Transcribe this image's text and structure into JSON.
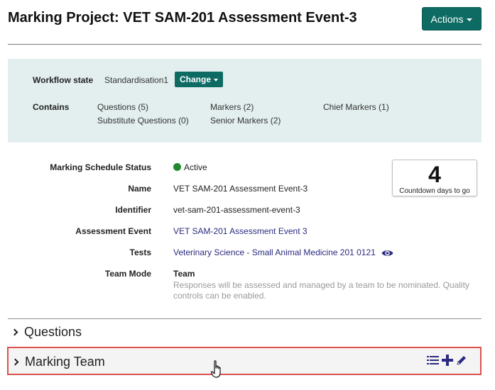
{
  "header": {
    "title": "Marking Project: VET SAM-201 Assessment Event-3",
    "actions_label": "Actions"
  },
  "summary": {
    "workflow_label": "Workflow state",
    "workflow_value": "Standardisation1",
    "change_label": "Change",
    "contains_label": "Contains",
    "questions": "Questions (5)",
    "substitute_questions": "Substitute Questions (0)",
    "markers": "Markers (2)",
    "senior_markers": "Senior Markers (2)",
    "chief_markers": "Chief Markers (1)"
  },
  "details": {
    "status_label": "Marking Schedule Status",
    "status_value": "Active",
    "status_color": "#1f8a2e",
    "name_label": "Name",
    "name_value": "VET SAM-201 Assessment Event-3",
    "identifier_label": "Identifier",
    "identifier_value": "vet-sam-201-assessment-event-3",
    "event_label": "Assessment Event",
    "event_value": "VET SAM-201 Assessment Event 3",
    "tests_label": "Tests",
    "tests_value": "Veterinary Science - Small Animal Medicine 201 0121",
    "team_mode_label": "Team Mode",
    "team_mode_value": "Team",
    "team_mode_desc": "Responses will be assessed and managed by a team to be nominated. Quality controls can be enabled."
  },
  "countdown": {
    "days": "4",
    "caption": "Countdown days to go"
  },
  "sections": {
    "questions": "Questions",
    "marking_team": "Marking Team"
  },
  "colors": {
    "accent": "#0d6b63",
    "panel_bg": "#e2efee",
    "highlight_border": "#d9534f",
    "link": "#2b2a80"
  },
  "icons": [
    "chevron-right-icon",
    "list-icon",
    "plus-icon",
    "pencil-icon",
    "eye-icon",
    "caret-down-icon",
    "hand-cursor-icon"
  ]
}
